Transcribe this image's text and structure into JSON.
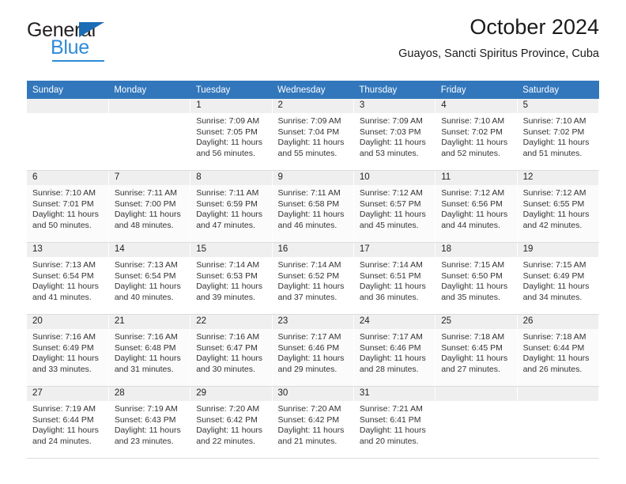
{
  "brand": {
    "name_part1": "General",
    "name_part2": "Blue",
    "triangle_icon": "triangle-icon",
    "accent_color": "#2e8bd8",
    "dark_color": "#231f20"
  },
  "header": {
    "title": "October 2024",
    "subtitle": "Guayos, Sancti Spiritus Province, Cuba"
  },
  "calendar": {
    "header_bg": "#3277bc",
    "weekdays": [
      "Sunday",
      "Monday",
      "Tuesday",
      "Wednesday",
      "Thursday",
      "Friday",
      "Saturday"
    ],
    "weeks": [
      [
        {
          "day": "",
          "sunrise": "",
          "sunset": "",
          "daylight1": "",
          "daylight2": ""
        },
        {
          "day": "",
          "sunrise": "",
          "sunset": "",
          "daylight1": "",
          "daylight2": ""
        },
        {
          "day": "1",
          "sunrise": "Sunrise: 7:09 AM",
          "sunset": "Sunset: 7:05 PM",
          "daylight1": "Daylight: 11 hours",
          "daylight2": "and 56 minutes."
        },
        {
          "day": "2",
          "sunrise": "Sunrise: 7:09 AM",
          "sunset": "Sunset: 7:04 PM",
          "daylight1": "Daylight: 11 hours",
          "daylight2": "and 55 minutes."
        },
        {
          "day": "3",
          "sunrise": "Sunrise: 7:09 AM",
          "sunset": "Sunset: 7:03 PM",
          "daylight1": "Daylight: 11 hours",
          "daylight2": "and 53 minutes."
        },
        {
          "day": "4",
          "sunrise": "Sunrise: 7:10 AM",
          "sunset": "Sunset: 7:02 PM",
          "daylight1": "Daylight: 11 hours",
          "daylight2": "and 52 minutes."
        },
        {
          "day": "5",
          "sunrise": "Sunrise: 7:10 AM",
          "sunset": "Sunset: 7:02 PM",
          "daylight1": "Daylight: 11 hours",
          "daylight2": "and 51 minutes."
        }
      ],
      [
        {
          "day": "6",
          "sunrise": "Sunrise: 7:10 AM",
          "sunset": "Sunset: 7:01 PM",
          "daylight1": "Daylight: 11 hours",
          "daylight2": "and 50 minutes."
        },
        {
          "day": "7",
          "sunrise": "Sunrise: 7:11 AM",
          "sunset": "Sunset: 7:00 PM",
          "daylight1": "Daylight: 11 hours",
          "daylight2": "and 48 minutes."
        },
        {
          "day": "8",
          "sunrise": "Sunrise: 7:11 AM",
          "sunset": "Sunset: 6:59 PM",
          "daylight1": "Daylight: 11 hours",
          "daylight2": "and 47 minutes."
        },
        {
          "day": "9",
          "sunrise": "Sunrise: 7:11 AM",
          "sunset": "Sunset: 6:58 PM",
          "daylight1": "Daylight: 11 hours",
          "daylight2": "and 46 minutes."
        },
        {
          "day": "10",
          "sunrise": "Sunrise: 7:12 AM",
          "sunset": "Sunset: 6:57 PM",
          "daylight1": "Daylight: 11 hours",
          "daylight2": "and 45 minutes."
        },
        {
          "day": "11",
          "sunrise": "Sunrise: 7:12 AM",
          "sunset": "Sunset: 6:56 PM",
          "daylight1": "Daylight: 11 hours",
          "daylight2": "and 44 minutes."
        },
        {
          "day": "12",
          "sunrise": "Sunrise: 7:12 AM",
          "sunset": "Sunset: 6:55 PM",
          "daylight1": "Daylight: 11 hours",
          "daylight2": "and 42 minutes."
        }
      ],
      [
        {
          "day": "13",
          "sunrise": "Sunrise: 7:13 AM",
          "sunset": "Sunset: 6:54 PM",
          "daylight1": "Daylight: 11 hours",
          "daylight2": "and 41 minutes."
        },
        {
          "day": "14",
          "sunrise": "Sunrise: 7:13 AM",
          "sunset": "Sunset: 6:54 PM",
          "daylight1": "Daylight: 11 hours",
          "daylight2": "and 40 minutes."
        },
        {
          "day": "15",
          "sunrise": "Sunrise: 7:14 AM",
          "sunset": "Sunset: 6:53 PM",
          "daylight1": "Daylight: 11 hours",
          "daylight2": "and 39 minutes."
        },
        {
          "day": "16",
          "sunrise": "Sunrise: 7:14 AM",
          "sunset": "Sunset: 6:52 PM",
          "daylight1": "Daylight: 11 hours",
          "daylight2": "and 37 minutes."
        },
        {
          "day": "17",
          "sunrise": "Sunrise: 7:14 AM",
          "sunset": "Sunset: 6:51 PM",
          "daylight1": "Daylight: 11 hours",
          "daylight2": "and 36 minutes."
        },
        {
          "day": "18",
          "sunrise": "Sunrise: 7:15 AM",
          "sunset": "Sunset: 6:50 PM",
          "daylight1": "Daylight: 11 hours",
          "daylight2": "and 35 minutes."
        },
        {
          "day": "19",
          "sunrise": "Sunrise: 7:15 AM",
          "sunset": "Sunset: 6:49 PM",
          "daylight1": "Daylight: 11 hours",
          "daylight2": "and 34 minutes."
        }
      ],
      [
        {
          "day": "20",
          "sunrise": "Sunrise: 7:16 AM",
          "sunset": "Sunset: 6:49 PM",
          "daylight1": "Daylight: 11 hours",
          "daylight2": "and 33 minutes."
        },
        {
          "day": "21",
          "sunrise": "Sunrise: 7:16 AM",
          "sunset": "Sunset: 6:48 PM",
          "daylight1": "Daylight: 11 hours",
          "daylight2": "and 31 minutes."
        },
        {
          "day": "22",
          "sunrise": "Sunrise: 7:16 AM",
          "sunset": "Sunset: 6:47 PM",
          "daylight1": "Daylight: 11 hours",
          "daylight2": "and 30 minutes."
        },
        {
          "day": "23",
          "sunrise": "Sunrise: 7:17 AM",
          "sunset": "Sunset: 6:46 PM",
          "daylight1": "Daylight: 11 hours",
          "daylight2": "and 29 minutes."
        },
        {
          "day": "24",
          "sunrise": "Sunrise: 7:17 AM",
          "sunset": "Sunset: 6:46 PM",
          "daylight1": "Daylight: 11 hours",
          "daylight2": "and 28 minutes."
        },
        {
          "day": "25",
          "sunrise": "Sunrise: 7:18 AM",
          "sunset": "Sunset: 6:45 PM",
          "daylight1": "Daylight: 11 hours",
          "daylight2": "and 27 minutes."
        },
        {
          "day": "26",
          "sunrise": "Sunrise: 7:18 AM",
          "sunset": "Sunset: 6:44 PM",
          "daylight1": "Daylight: 11 hours",
          "daylight2": "and 26 minutes."
        }
      ],
      [
        {
          "day": "27",
          "sunrise": "Sunrise: 7:19 AM",
          "sunset": "Sunset: 6:44 PM",
          "daylight1": "Daylight: 11 hours",
          "daylight2": "and 24 minutes."
        },
        {
          "day": "28",
          "sunrise": "Sunrise: 7:19 AM",
          "sunset": "Sunset: 6:43 PM",
          "daylight1": "Daylight: 11 hours",
          "daylight2": "and 23 minutes."
        },
        {
          "day": "29",
          "sunrise": "Sunrise: 7:20 AM",
          "sunset": "Sunset: 6:42 PM",
          "daylight1": "Daylight: 11 hours",
          "daylight2": "and 22 minutes."
        },
        {
          "day": "30",
          "sunrise": "Sunrise: 7:20 AM",
          "sunset": "Sunset: 6:42 PM",
          "daylight1": "Daylight: 11 hours",
          "daylight2": "and 21 minutes."
        },
        {
          "day": "31",
          "sunrise": "Sunrise: 7:21 AM",
          "sunset": "Sunset: 6:41 PM",
          "daylight1": "Daylight: 11 hours",
          "daylight2": "and 20 minutes."
        },
        {
          "day": "",
          "sunrise": "",
          "sunset": "",
          "daylight1": "",
          "daylight2": ""
        },
        {
          "day": "",
          "sunrise": "",
          "sunset": "",
          "daylight1": "",
          "daylight2": ""
        }
      ]
    ]
  }
}
